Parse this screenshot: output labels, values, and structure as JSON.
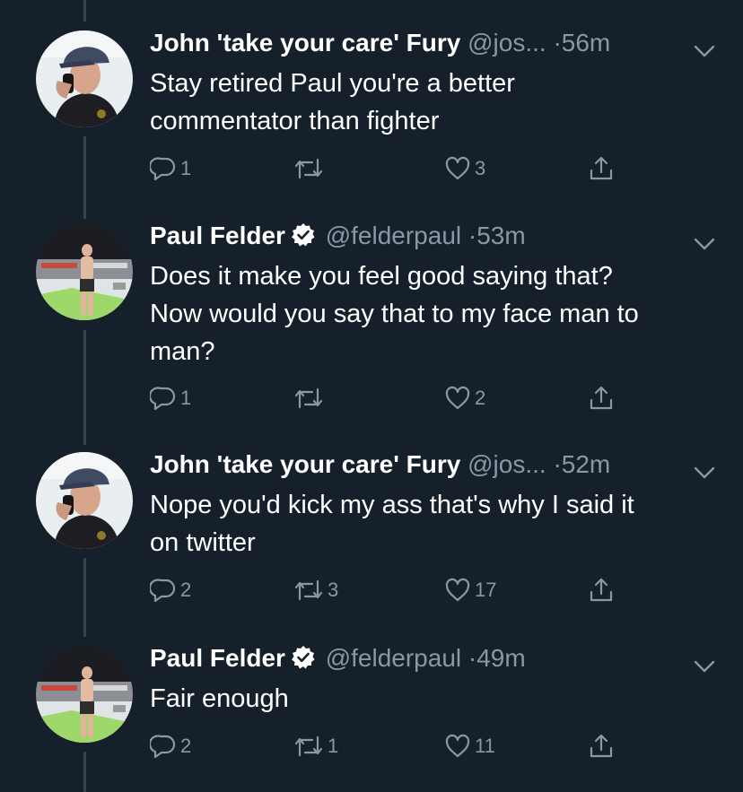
{
  "colors": {
    "background": "#15202b",
    "text": "#ffffff",
    "secondary": "#8899a6",
    "thread_line": "#38444d",
    "verified": "#ffffff"
  },
  "tweets": [
    {
      "name": "John 'take your care' Fury",
      "handle": "@jos...",
      "sep": "·",
      "time": "56m",
      "verified": false,
      "avatar": "john-fury-avatar",
      "text_lines": [
        "Stay retired Paul you're a better",
        "commentator than fighter"
      ],
      "replies": "1",
      "retweets": "",
      "likes": "3"
    },
    {
      "name": "Paul Felder",
      "handle": "@felderpaul",
      "sep": "·",
      "time": "53m",
      "verified": true,
      "avatar": "paul-felder-avatar",
      "text_lines": [
        "Does it make you feel good saying that?",
        "Now would you say that to my face man to",
        "man?"
      ],
      "replies": "1",
      "retweets": "",
      "likes": "2"
    },
    {
      "name": "John 'take your care' Fury",
      "handle": "@jos...",
      "sep": "·",
      "time": "52m",
      "verified": false,
      "avatar": "john-fury-avatar",
      "text_lines": [
        "Nope you'd kick my ass that's why I said it",
        "on twitter"
      ],
      "replies": "2",
      "retweets": "3",
      "likes": "17"
    },
    {
      "name": "Paul Felder",
      "handle": "@felderpaul",
      "sep": "·",
      "time": "49m",
      "verified": true,
      "avatar": "paul-felder-avatar",
      "text_lines": [
        "Fair enough"
      ],
      "replies": "2",
      "retweets": "1",
      "likes": "11"
    }
  ]
}
